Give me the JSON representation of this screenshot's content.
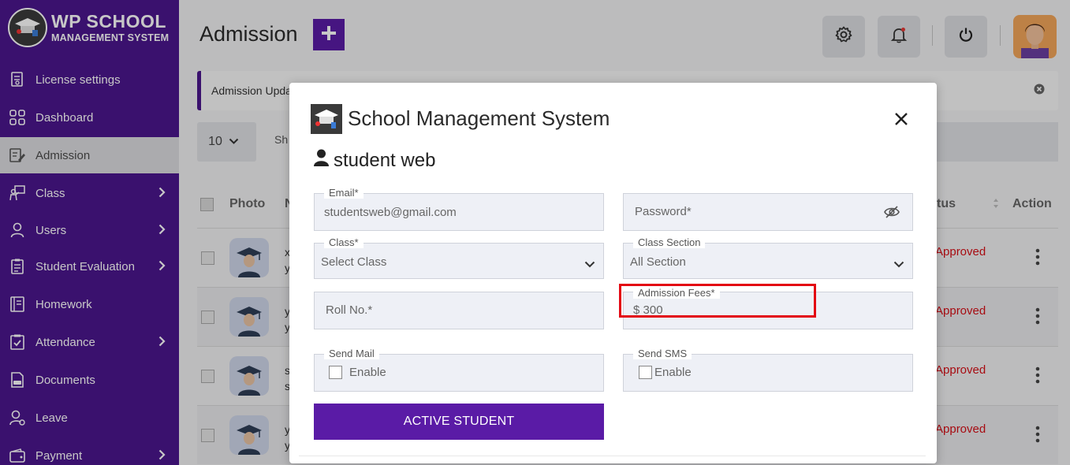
{
  "brand": {
    "line1": "WP SCHOOL",
    "line2": "MANAGEMENT SYSTEM"
  },
  "sidebar": {
    "items": [
      {
        "label": "License settings",
        "icon": "license-icon",
        "has_children": false,
        "active": false
      },
      {
        "label": "Dashboard",
        "icon": "dashboard-grid-icon",
        "has_children": false,
        "active": false
      },
      {
        "label": "Admission",
        "icon": "admission-edit-icon",
        "has_children": false,
        "active": true
      },
      {
        "label": "Class",
        "icon": "class-icon",
        "has_children": true,
        "active": false
      },
      {
        "label": "Users",
        "icon": "user-icon",
        "has_children": true,
        "active": false
      },
      {
        "label": "Student Evaluation",
        "icon": "evaluation-icon",
        "has_children": true,
        "active": false
      },
      {
        "label": "Homework",
        "icon": "homework-icon",
        "has_children": false,
        "active": false
      },
      {
        "label": "Attendance",
        "icon": "attendance-icon",
        "has_children": true,
        "active": false
      },
      {
        "label": "Documents",
        "icon": "documents-icon",
        "has_children": false,
        "active": false
      },
      {
        "label": "Leave",
        "icon": "leave-icon",
        "has_children": false,
        "active": false
      },
      {
        "label": "Payment",
        "icon": "payment-icon",
        "has_children": true,
        "active": false
      }
    ]
  },
  "header": {
    "title": "Admission",
    "add_icon": "plus-icon",
    "settings_icon": "gear-icon",
    "notification_icon": "bell-icon",
    "power_icon": "power-icon"
  },
  "alert": {
    "text": "Admission Upda"
  },
  "table": {
    "per_page": "10",
    "show_text": "Sh",
    "columns": {
      "photo": "Photo",
      "name": "N",
      "status": "tus",
      "action": "Action"
    },
    "rows": [
      {
        "name1": "x",
        "name2": "y",
        "status": "Approved"
      },
      {
        "name1": "y",
        "name2": "y",
        "status": "Approved"
      },
      {
        "name1": "s",
        "name2": "s",
        "status": "Approved"
      },
      {
        "name1": "y",
        "name2": "y",
        "status": "Approved"
      }
    ]
  },
  "modal": {
    "title": "School Management System",
    "student_name": "student web",
    "email": {
      "label": "Email*",
      "value": "studentsweb@gmail.com"
    },
    "password": {
      "placeholder": "Password*"
    },
    "class": {
      "label": "Class*",
      "value": "Select Class"
    },
    "class_section": {
      "label": "Class Section",
      "value": "All Section"
    },
    "roll_no": {
      "placeholder": "Roll No.*"
    },
    "admission_fees": {
      "label": "Admission Fees*",
      "value": "$ 300"
    },
    "send_mail": {
      "label": "Send Mail",
      "option": "Enable",
      "checked": false
    },
    "send_sms": {
      "label": "Send SMS",
      "option": "Enable",
      "checked": false
    },
    "submit_label": "ACTIVE STUDENT"
  },
  "colors": {
    "brand_purple": "#4b168d",
    "button_purple": "#5a1ba6",
    "approved_red": "#d60f16",
    "highlight_red": "#e30612"
  }
}
